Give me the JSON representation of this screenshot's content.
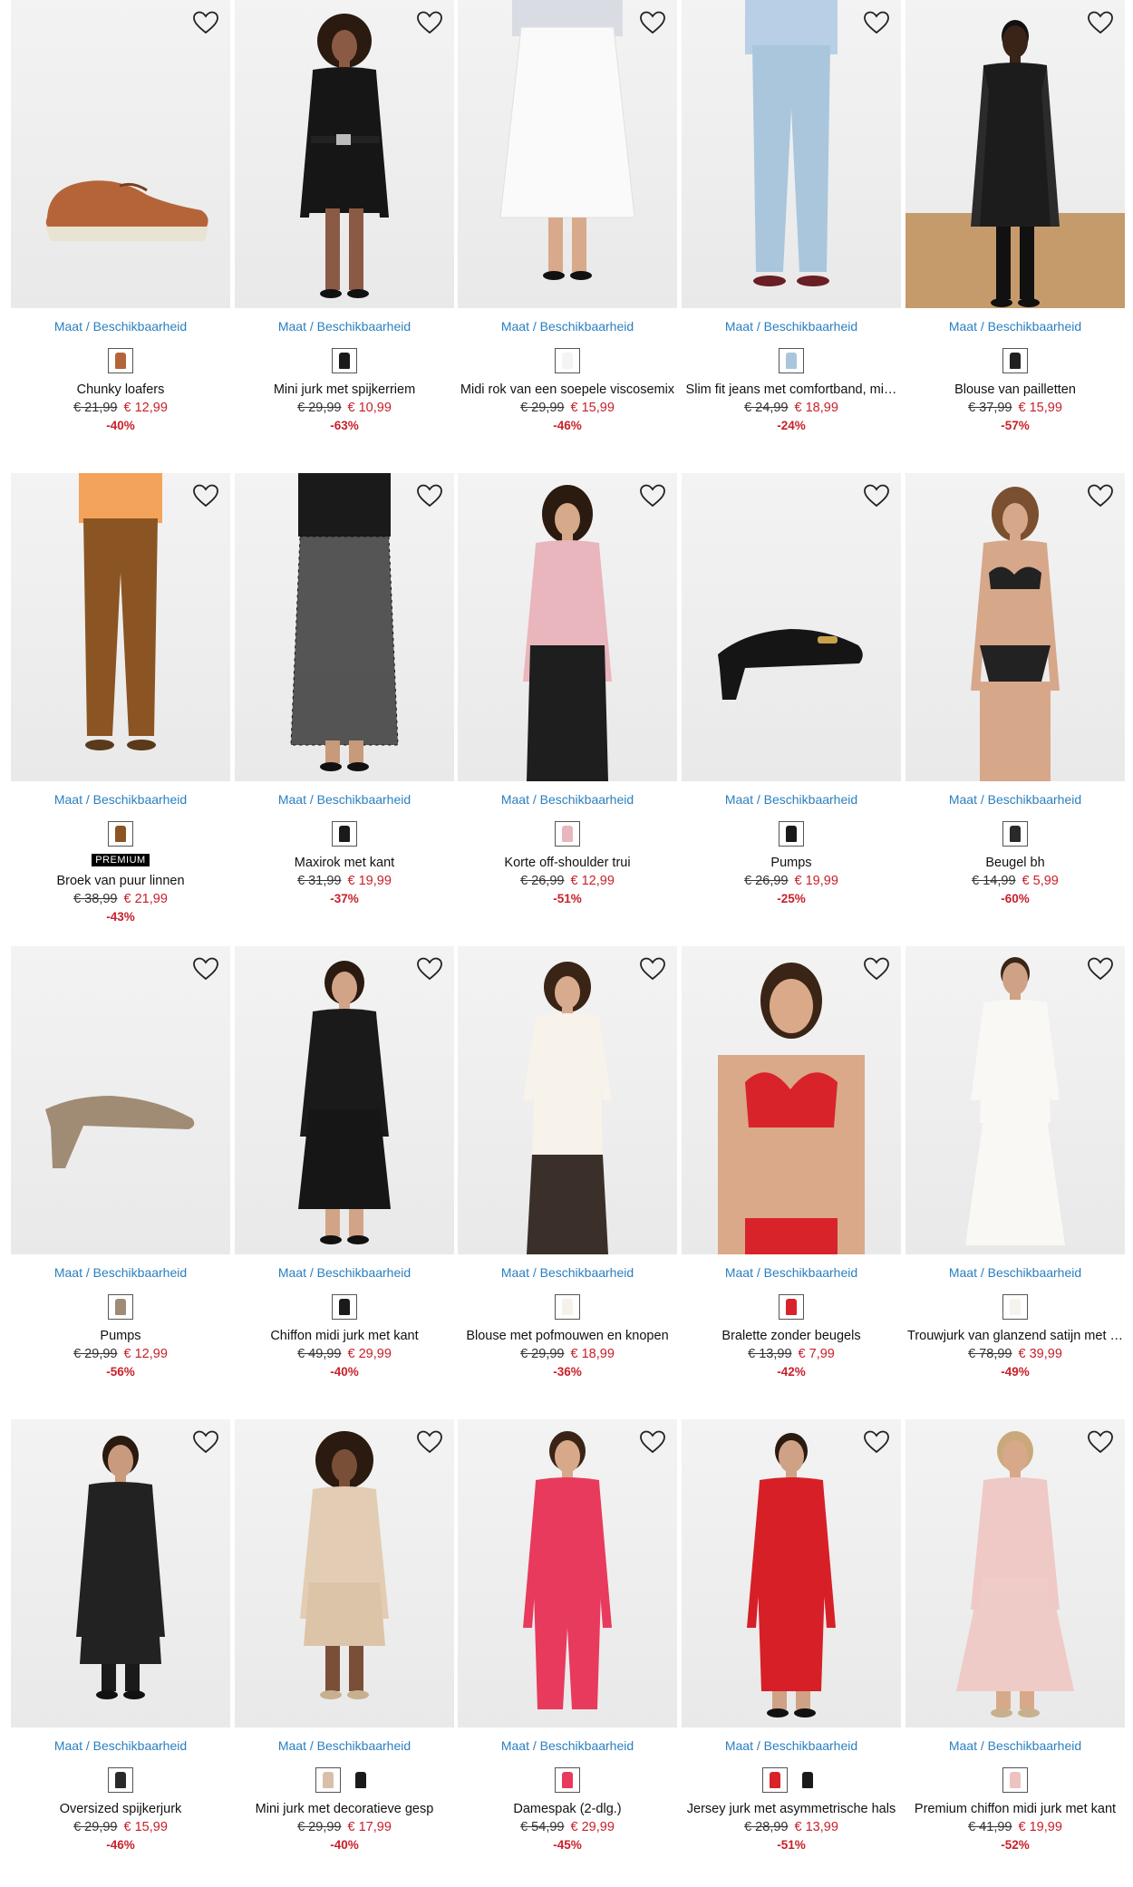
{
  "colors": {
    "accent": "#2a7fbf",
    "sale": "#c8202a",
    "text": "#111111"
  },
  "common": {
    "maat_label": "Maat / Beschikbaarheid",
    "favorite_icon": "heart-outline-icon"
  },
  "products": [
    {
      "name": "Chunky loafers",
      "old_price": "€ 21,99",
      "new_price": "€ 12,99",
      "discount": "-40%",
      "figure": "loafer",
      "badge": "",
      "swatches": [
        "#b5643a"
      ]
    },
    {
      "name": "Mini jurk met spijkerriem",
      "old_price": "€ 29,99",
      "new_price": "€ 10,99",
      "discount": "-63%",
      "figure": "dress-short",
      "badge": "",
      "swatches": [
        "#1a1a1a"
      ]
    },
    {
      "name": "Midi rok van een soepele viscosemix",
      "old_price": "€ 29,99",
      "new_price": "€ 15,99",
      "discount": "-46%",
      "figure": "skirt-white",
      "badge": "",
      "swatches": [
        "#f4f4f4"
      ]
    },
    {
      "name": "Slim fit jeans met comfortband, mi…",
      "old_price": "€ 24,99",
      "new_price": "€ 18,99",
      "discount": "-24%",
      "figure": "jeans",
      "badge": "",
      "swatches": [
        "#a9c6dc"
      ]
    },
    {
      "name": "Blouse van pailletten",
      "old_price": "€ 37,99",
      "new_price": "€ 15,99",
      "discount": "-57%",
      "figure": "sequin",
      "badge": "",
      "swatches": [
        "#202020"
      ]
    },
    {
      "name": "Broek van puur linnen",
      "old_price": "€ 38,99",
      "new_price": "€ 21,99",
      "discount": "-43%",
      "figure": "trousers-brown",
      "badge": "PREMIUM",
      "swatches": [
        "#8a5523"
      ]
    },
    {
      "name": "Maxirok met kant",
      "old_price": "€ 31,99",
      "new_price": "€ 19,99",
      "discount": "-37%",
      "figure": "skirt-lace",
      "badge": "",
      "swatches": [
        "#1a1a1a"
      ]
    },
    {
      "name": "Korte off-shoulder trui",
      "old_price": "€ 26,99",
      "new_price": "€ 12,99",
      "discount": "-51%",
      "figure": "offshoulder",
      "badge": "",
      "swatches": [
        "#e8b6bc"
      ]
    },
    {
      "name": "Pumps",
      "old_price": "€ 26,99",
      "new_price": "€ 19,99",
      "discount": "-25%",
      "figure": "pump-black",
      "badge": "",
      "swatches": [
        "#1a1a1a"
      ]
    },
    {
      "name": "Beugel bh",
      "old_price": "€ 14,99",
      "new_price": "€ 5,99",
      "discount": "-60%",
      "figure": "lingerie",
      "badge": "",
      "swatches": [
        "#2a2a2a"
      ]
    },
    {
      "name": "Pumps",
      "old_price": "€ 29,99",
      "new_price": "€ 12,99",
      "discount": "-56%",
      "figure": "pump-taupe",
      "badge": "",
      "swatches": [
        "#a08b74"
      ]
    },
    {
      "name": "Chiffon midi jurk met kant",
      "old_price": "€ 49,99",
      "new_price": "€ 29,99",
      "discount": "-40%",
      "figure": "dress-midi",
      "badge": "",
      "swatches": [
        "#1a1a1a"
      ]
    },
    {
      "name": "Blouse met pofmouwen en knopen",
      "old_price": "€ 29,99",
      "new_price": "€ 18,99",
      "discount": "-36%",
      "figure": "blouse-white",
      "badge": "",
      "swatches": [
        "#f6f1ea"
      ]
    },
    {
      "name": "Bralette zonder beugels",
      "old_price": "€ 13,99",
      "new_price": "€ 7,99",
      "discount": "-42%",
      "figure": "bralette-red",
      "badge": "",
      "swatches": [
        "#d9232b"
      ]
    },
    {
      "name": "Trouwjurk van glanzend satijn met …",
      "old_price": "€ 78,99",
      "new_price": "€ 39,99",
      "discount": "-49%",
      "figure": "gown-white",
      "badge": "",
      "swatches": [
        "#f6f3ee"
      ]
    },
    {
      "name": "Oversized spijkerjurk",
      "old_price": "€ 29,99",
      "new_price": "€ 15,99",
      "discount": "-46%",
      "figure": "shirtdress",
      "badge": "",
      "swatches": [
        "#2a2a2a"
      ]
    },
    {
      "name": "Mini jurk met decoratieve gesp",
      "old_price": "€ 29,99",
      "new_price": "€ 17,99",
      "discount": "-40%",
      "figure": "dress-gold",
      "badge": "",
      "swatches": [
        "#d8c0a8",
        "#1a1a1a"
      ]
    },
    {
      "name": "Damespak (2-dlg.)",
      "old_price": "€ 54,99",
      "new_price": "€ 29,99",
      "discount": "-45%",
      "figure": "suit-pink",
      "badge": "",
      "swatches": [
        "#e83a5c"
      ]
    },
    {
      "name": "Jersey jurk met asymmetrische hals",
      "old_price": "€ 28,99",
      "new_price": "€ 13,99",
      "discount": "-51%",
      "figure": "dress-red",
      "badge": "",
      "swatches": [
        "#d9232b",
        "#1a1a1a"
      ]
    },
    {
      "name": "Premium chiffon midi jurk met kant",
      "old_price": "€ 41,99",
      "new_price": "€ 19,99",
      "discount": "-52%",
      "figure": "dress-pink",
      "badge": "",
      "swatches": [
        "#ecc3c1"
      ]
    }
  ]
}
